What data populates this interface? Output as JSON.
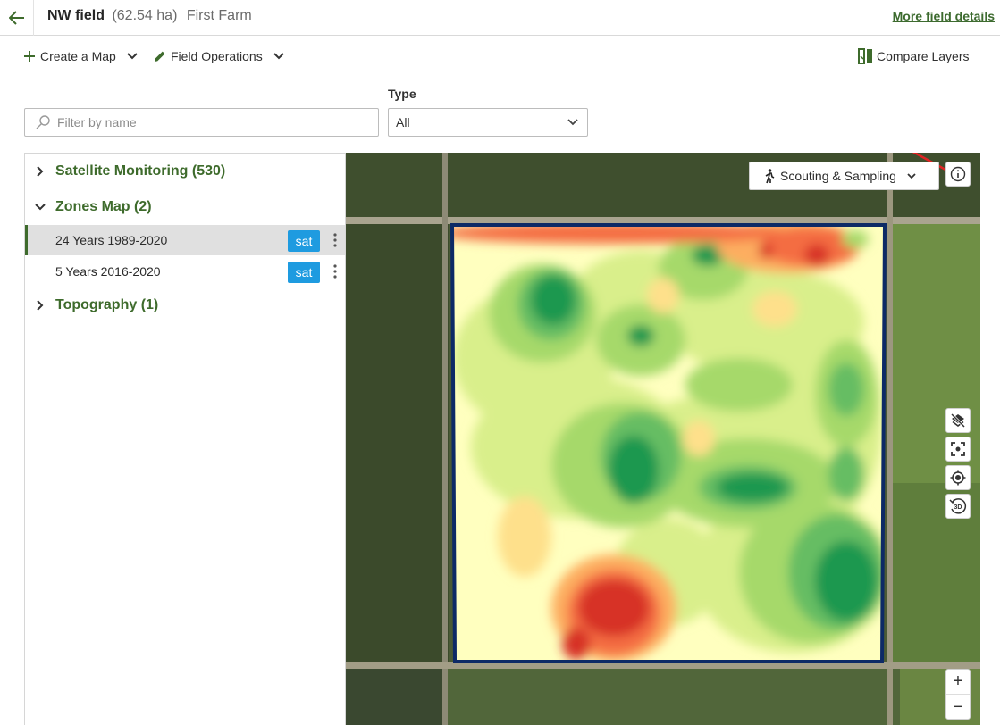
{
  "header": {
    "field_name": "NW field",
    "area": "(62.54 ha)",
    "farm": "First Farm",
    "more_link": "More field details"
  },
  "toolbar": {
    "create_map": "Create a Map",
    "field_operations": "Field Operations",
    "compare_layers": "Compare Layers"
  },
  "filters": {
    "search_placeholder": "Filter by name",
    "type_label": "Type",
    "type_value": "All"
  },
  "sidebar": {
    "groups": [
      {
        "label": "Satellite Monitoring (530)",
        "expanded": false
      },
      {
        "label": "Zones Map (2)",
        "expanded": true,
        "items": [
          {
            "label": "24 Years 1989-2020",
            "badge": "sat",
            "selected": true
          },
          {
            "label": "5 Years 2016-2020",
            "badge": "sat",
            "selected": false
          }
        ]
      },
      {
        "label": "Topography (1)",
        "expanded": false
      }
    ]
  },
  "map": {
    "scouting_label": "Scouting & Sampling",
    "controls": [
      "layers-off-icon",
      "focus-field-icon",
      "my-location-icon",
      "3d-rotate-icon",
      "info-icon"
    ],
    "zoom_in": "+",
    "zoom_out": "−",
    "btn_3d": "3D"
  },
  "colors": {
    "brand_green": "#3e6b2c",
    "badge_blue": "#1e9be0",
    "annotation_red": "#e02424",
    "field_border": "#0d2a66",
    "zone_scale": [
      "#d73027",
      "#f46d43",
      "#fdae61",
      "#fee08b",
      "#ffffbf",
      "#d9ef8b",
      "#a6d96a",
      "#66bd63",
      "#1a9850"
    ]
  }
}
